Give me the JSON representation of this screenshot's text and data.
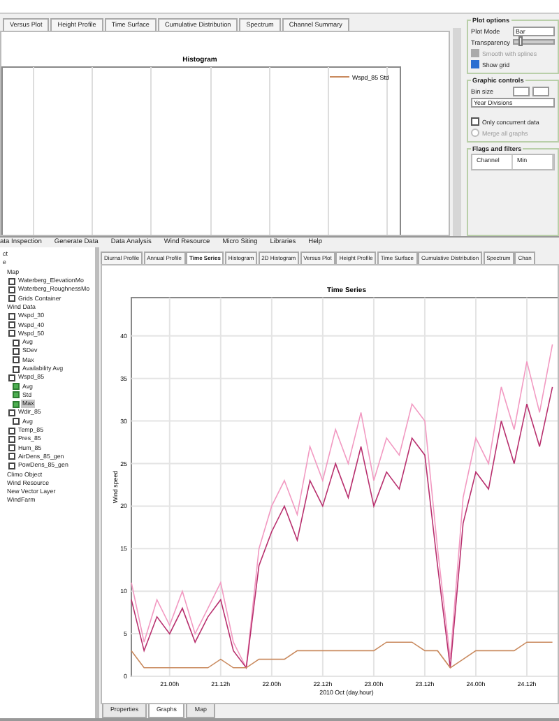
{
  "back_window": {
    "tabs": [
      {
        "label": "Versus Plot",
        "selected": false
      },
      {
        "label": "Height Profile",
        "selected": false
      },
      {
        "label": "Time Surface",
        "selected": false
      },
      {
        "label": "Cumulative Distribution",
        "selected": false
      },
      {
        "label": "Spectrum",
        "selected": false
      },
      {
        "label": "Channel Summary",
        "selected": false
      }
    ],
    "chart": {
      "title": "Histogram",
      "legend": [
        {
          "label": "Wspd_85 Std",
          "color": "#c98a5e"
        }
      ]
    },
    "plot_options": {
      "title": "Plot options",
      "plot_mode_label": "Plot Mode",
      "plot_mode": "Bar",
      "transparency_label": "Transparency",
      "transparency": {
        "level": 0.12
      },
      "options": [
        {
          "label": "Smooth with splines",
          "checked": true,
          "disabled": true
        },
        {
          "label": "Show grid",
          "checked": true,
          "disabled": false
        }
      ]
    },
    "graphic_controls": {
      "title": "Graphic controls",
      "bin_size_label": "Bin size",
      "divisions": "Year Divisions",
      "options": [
        {
          "kind": "checkbox",
          "label": "Only concurrent data",
          "checked": false,
          "disabled": false
        },
        {
          "kind": "radio",
          "label": "Merge all graphs",
          "checked": false,
          "disabled": true
        }
      ]
    },
    "flags": {
      "title": "Flags and filters",
      "columns": [
        "Channel",
        "Min"
      ]
    }
  },
  "main_window": {
    "menu": [
      "ata Inspection",
      "Generate Data",
      "Data Analysis",
      "Wind Resource",
      "Micro Siting",
      "Libraries",
      "Help"
    ],
    "tree": [
      {
        "label": "ct",
        "kind": "folder",
        "selected": false
      },
      {
        "label": "e",
        "kind": "folder",
        "selected": false,
        "children": [
          {
            "label": "Map",
            "kind": "folder",
            "selected": false,
            "children": [
              {
                "label": "Waterberg_ElevationMo",
                "kind": "channel",
                "checked": false,
                "selected": false
              },
              {
                "label": "Waterberg_RoughnessMo",
                "kind": "channel",
                "checked": false,
                "selected": false
              },
              {
                "label": "Grids Container",
                "kind": "channel",
                "checked": false,
                "selected": false
              }
            ]
          },
          {
            "label": "Wind Data",
            "kind": "folder",
            "selected": false,
            "children": [
              {
                "label": "Wspd_30",
                "kind": "channel",
                "checked": false,
                "selected": false
              },
              {
                "label": "Wspd_40",
                "kind": "channel",
                "checked": false,
                "selected": false
              },
              {
                "label": "Wspd_50",
                "kind": "channel",
                "checked": false,
                "selected": false,
                "children": [
                  {
                    "label": "Avg",
                    "kind": "channel",
                    "checked": false,
                    "selected": false
                  },
                  {
                    "label": "SDev",
                    "kind": "channel",
                    "checked": false,
                    "selected": false
                  },
                  {
                    "label": "Max",
                    "kind": "channel",
                    "checked": false,
                    "selected": false
                  },
                  {
                    "label": "Availability Avg",
                    "kind": "channel",
                    "checked": false,
                    "selected": false
                  }
                ]
              },
              {
                "label": "Wspd_85",
                "kind": "channel",
                "checked": false,
                "selected": false,
                "children": [
                  {
                    "label": "Avg",
                    "kind": "channel",
                    "checked": true,
                    "selected": false
                  },
                  {
                    "label": "Std",
                    "kind": "channel",
                    "checked": true,
                    "selected": false
                  },
                  {
                    "label": "Max",
                    "kind": "channel",
                    "checked": true,
                    "selected": true
                  }
                ]
              },
              {
                "label": "Wdir_85",
                "kind": "channel",
                "checked": false,
                "selected": false,
                "children": [
                  {
                    "label": "Avg",
                    "kind": "channel",
                    "checked": false,
                    "selected": false
                  }
                ]
              },
              {
                "label": "Temp_85",
                "kind": "channel",
                "checked": false,
                "selected": false
              },
              {
                "label": "Pres_85",
                "kind": "channel",
                "checked": false,
                "selected": false
              },
              {
                "label": "Hum_85",
                "kind": "channel",
                "checked": false,
                "selected": false
              },
              {
                "label": "AirDens_85_gen",
                "kind": "channel",
                "checked": false,
                "selected": false
              },
              {
                "label": "PowDens_85_gen",
                "kind": "channel",
                "checked": false,
                "selected": false
              }
            ]
          },
          {
            "label": "Climo Object",
            "kind": "folder",
            "selected": false
          },
          {
            "label": "Wind Resource",
            "kind": "folder",
            "selected": false
          },
          {
            "label": "New Vector Layer",
            "kind": "folder",
            "selected": false
          },
          {
            "label": "WindFarm",
            "kind": "folder",
            "selected": false
          }
        ]
      }
    ],
    "tabs": [
      {
        "label": "Diurnal Profile",
        "selected": false
      },
      {
        "label": "Annual Profile",
        "selected": false
      },
      {
        "label": "Time Series",
        "selected": true
      },
      {
        "label": "Histogram",
        "selected": false
      },
      {
        "label": "2D Histogram",
        "selected": false
      },
      {
        "label": "Versus Plot",
        "selected": false
      },
      {
        "label": "Height Profile",
        "selected": false
      },
      {
        "label": "Time Surface",
        "selected": false
      },
      {
        "label": "Cumulative Distribution",
        "selected": false
      },
      {
        "label": "Spectrum",
        "selected": false
      },
      {
        "label": "Chan",
        "selected": false
      }
    ],
    "chart_data": {
      "type": "line",
      "title": "Time Series",
      "xlabel": "2010 Oct (day.hour)",
      "ylabel": "Wind speed",
      "categories": [
        null,
        null,
        null,
        "21.00h",
        null,
        null,
        null,
        "21.12h",
        null,
        null,
        null,
        "22.00h",
        null,
        null,
        null,
        "22.12h",
        null,
        null,
        null,
        "23.00h",
        null,
        null,
        null,
        "23.12h",
        null,
        null,
        null,
        "24.00h",
        null,
        null,
        null,
        "24.12h",
        null,
        null
      ],
      "series": [
        {
          "color": "#f29ac2",
          "values": [
            11,
            4,
            9,
            6,
            10,
            5,
            8,
            11,
            4,
            1,
            15,
            20,
            23,
            19,
            27,
            23,
            29,
            25,
            31,
            23,
            28,
            26,
            32,
            30,
            15,
            2,
            21,
            28,
            25,
            34,
            29,
            37,
            31,
            39
          ]
        },
        {
          "color": "#b8306e",
          "values": [
            9,
            3,
            7,
            5,
            8,
            4,
            7,
            9,
            3,
            1,
            13,
            17,
            20,
            16,
            23,
            20,
            25,
            21,
            27,
            20,
            24,
            22,
            28,
            26,
            13,
            1,
            18,
            24,
            22,
            30,
            25,
            32,
            27,
            34
          ]
        },
        {
          "color": "#c98a5e",
          "values": [
            3,
            1,
            1,
            1,
            1,
            1,
            1,
            2,
            1,
            1,
            2,
            2,
            2,
            3,
            3,
            3,
            3,
            3,
            3,
            3,
            4,
            4,
            4,
            3,
            3,
            1,
            2,
            3,
            3,
            3,
            3,
            4,
            4,
            4
          ]
        }
      ],
      "ylim": [
        0,
        44.5
      ],
      "grid": true,
      "yticks": [
        0,
        5,
        10,
        15,
        20,
        25,
        30,
        35,
        40
      ]
    },
    "bottom_tabs": [
      {
        "label": "Properties",
        "selected": false
      },
      {
        "label": "Graphs",
        "selected": true
      },
      {
        "label": "Map",
        "selected": false
      }
    ]
  }
}
